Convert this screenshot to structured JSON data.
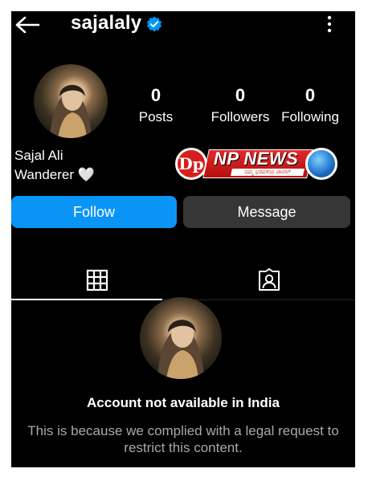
{
  "header": {
    "username": "sajalaly"
  },
  "stats": [
    {
      "value": "0",
      "label": "Posts"
    },
    {
      "value": "0",
      "label": "Followers"
    },
    {
      "value": "0",
      "label": "Following"
    }
  ],
  "bio": {
    "name": "Sajal Ali",
    "text": "Wanderer 🤍"
  },
  "watermark": {
    "title": "NP NEWS",
    "tagline": "ನಮ್ಮ ಭರವಸೆಯ ಚಾನೆಲ್"
  },
  "actions": {
    "follow": "Follow",
    "message": "Message"
  },
  "restriction": {
    "title": "Account not available in India",
    "body": "This is because we complied with a legal request to restrict this content."
  },
  "colors": {
    "background": "#000000",
    "follow_button": "#0a95f6",
    "message_button": "#363636",
    "verified_badge": "#0095f6",
    "muted_text": "#a8a8a8"
  }
}
